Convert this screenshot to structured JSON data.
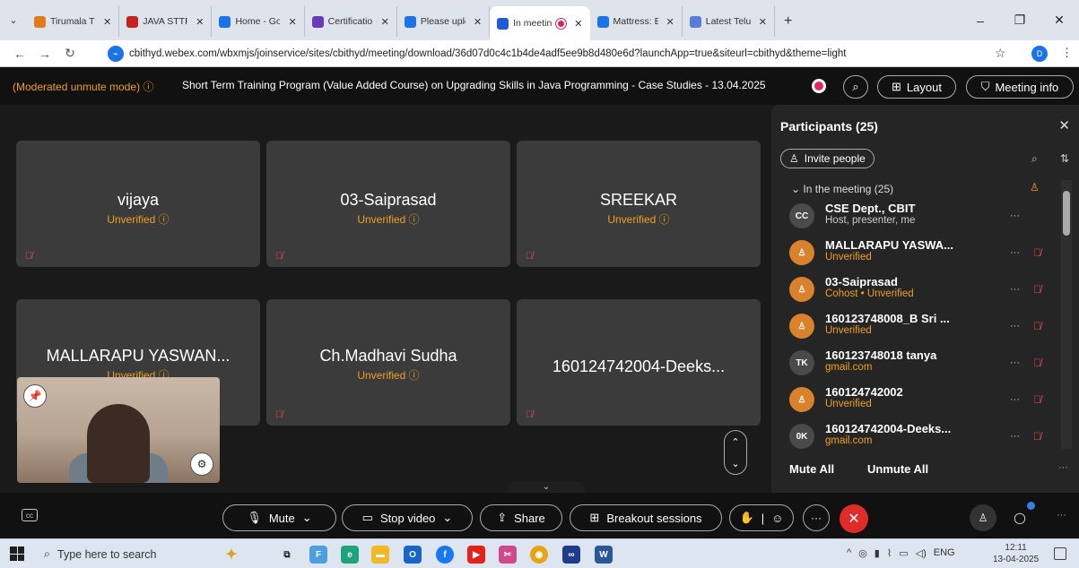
{
  "browser": {
    "tabs": [
      {
        "label": "Tirumala Tir",
        "color": "#e07b1a"
      },
      {
        "label": "JAVA STTP D",
        "color": "#c5221f"
      },
      {
        "label": "Home - Goo",
        "color": "#1a73e8"
      },
      {
        "label": "Certification",
        "color": "#673ab7"
      },
      {
        "label": "Please uplo",
        "color": "#1a73e8"
      },
      {
        "label": "In meetin",
        "color": "#1f5bd6",
        "active": true
      },
      {
        "label": "Mattress: Bu",
        "color": "#1a73e8"
      },
      {
        "label": "Latest Telugi",
        "color": "#5b7bd6"
      }
    ],
    "url": "cbithyd.webex.com/wbxmjs/joinservice/sites/cbithyd/meeting/download/36d07d0c4c1b4de4adf5ee9b8d480e6d?launchApp=true&siteurl=cbithyd&theme=light",
    "profile_initial": "D"
  },
  "meeting": {
    "mode": "(Moderated unmute mode)",
    "title": "Short Term Training Program (Value Added Course) on Upgrading Skills in Java Programming - Case Studies - 13.04.2025",
    "layout_label": "Layout",
    "info_label": "Meeting info",
    "tiles": [
      {
        "name": "vijaya",
        "status": "Unverified"
      },
      {
        "name": "03-Saiprasad",
        "status": "Unverified"
      },
      {
        "name": "SREEKAR",
        "status": "Unverified"
      },
      {
        "name": "MALLARAPU YASWAN...",
        "status": "Unverified"
      },
      {
        "name": "Ch.Madhavi Sudha",
        "status": "Unverified"
      },
      {
        "name": "160124742004-Deeks...",
        "status": ""
      }
    ]
  },
  "panel": {
    "title": "Participants (25)",
    "invite_label": "Invite people",
    "section_label": "In the meeting (25)",
    "participants": [
      {
        "initials": "CC",
        "name": "CSE Dept., CBIT",
        "sub": "Host, presenter, me",
        "avatar_color": "#4a4a4a",
        "sub_color": "#cccccc"
      },
      {
        "initials": "",
        "name": "MALLARAPU YASWA...",
        "sub": "Unverified",
        "avatar_color": "#d9822b",
        "sub_color": "#f0a020"
      },
      {
        "initials": "",
        "name": "03-Saiprasad",
        "sub": "Cohost • Unverified",
        "avatar_color": "#d9822b",
        "sub_color": "#f0a020"
      },
      {
        "initials": "",
        "name": "160123748008_B Sri ...",
        "sub": "Unverified",
        "avatar_color": "#d9822b",
        "sub_color": "#f0a020"
      },
      {
        "initials": "TK",
        "name": "160123748018 tanya",
        "sub": "gmail.com",
        "avatar_color": "#4a4a4a",
        "sub_color": "#f0a020"
      },
      {
        "initials": "",
        "name": "160124742002",
        "sub": "Unverified",
        "avatar_color": "#d9822b",
        "sub_color": "#f0a020"
      },
      {
        "initials": "0K",
        "name": "160124742004-Deeks...",
        "sub": "gmail.com",
        "avatar_color": "#4a4a4a",
        "sub_color": "#f0a020"
      }
    ],
    "mute_all": "Mute All",
    "unmute_all": "Unmute All"
  },
  "controls": {
    "mute": "Mute",
    "stop_video": "Stop video",
    "share": "Share",
    "breakout": "Breakout sessions"
  },
  "taskbar": {
    "search_placeholder": "Type here to search",
    "lang": "ENG",
    "time": "12:11",
    "date": "13-04-2025"
  }
}
